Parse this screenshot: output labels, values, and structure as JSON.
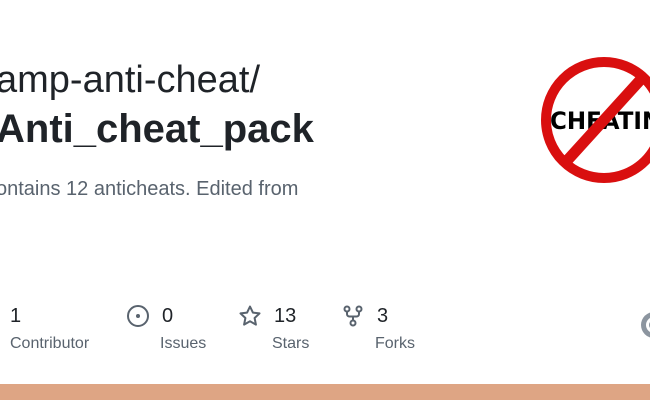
{
  "repo": {
    "owner": "amp-anti-cheat/",
    "name": "Anti_cheat_pack",
    "description": "ontains 12 anticheats. Edited from"
  },
  "logo": {
    "text": "CHEATING",
    "ring_color": "#d90f0f",
    "text_color": "#000000"
  },
  "stats": [
    {
      "icon": "people-icon",
      "value": "1",
      "label": "Contributor"
    },
    {
      "icon": "issue-icon",
      "value": "0",
      "label": "Issues"
    },
    {
      "icon": "star-icon",
      "value": "13",
      "label": "Stars"
    },
    {
      "icon": "fork-icon",
      "value": "3",
      "label": "Forks"
    }
  ],
  "language_bar": {
    "color": "#dea584"
  },
  "colors": {
    "text_primary": "#1f2328",
    "text_secondary": "#59636e"
  }
}
